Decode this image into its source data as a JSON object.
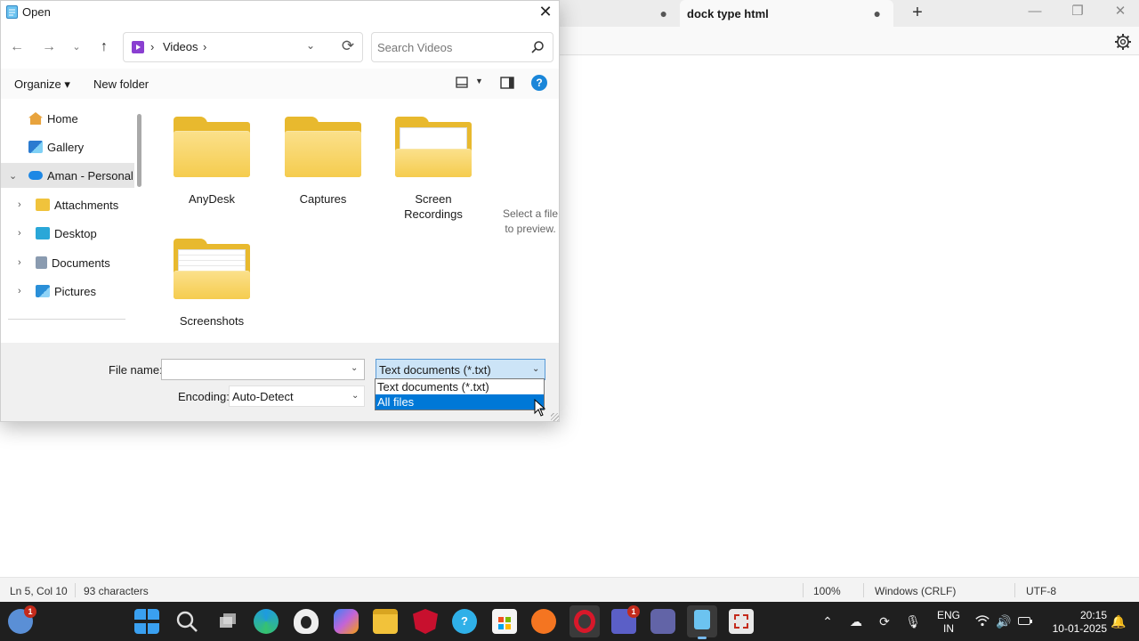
{
  "notepad": {
    "tabs": [
      {
        "label": ""
      },
      {
        "label": "dock type html"
      }
    ],
    "tab_dot": "●",
    "new_tab": "+",
    "status": {
      "position": "Ln 5, Col 10",
      "characters": "93 characters",
      "zoom": "100%",
      "line_ending": "Windows (CRLF)",
      "encoding": "UTF-8"
    }
  },
  "dialog": {
    "title": "Open",
    "close": "✕",
    "address": {
      "location": "Videos",
      "chevron": "›"
    },
    "search": {
      "placeholder": "Search Videos",
      "value": ""
    },
    "commands": {
      "organize": "Organize ▾",
      "new_folder": "New folder",
      "help": "?"
    },
    "nav_pane": {
      "items": [
        {
          "label": "Home",
          "icon": "home-icon",
          "color": "#e8a33d"
        },
        {
          "label": "Gallery",
          "icon": "gallery-icon",
          "color": "#2b7bd0"
        },
        {
          "label": "Aman - Personal",
          "icon": "onedrive-icon",
          "color": "#1e88e5"
        },
        {
          "label": "Attachments",
          "icon": "folder-icon",
          "color": "#f0c33c"
        },
        {
          "label": "Desktop",
          "icon": "desktop-icon",
          "color": "#2aa7d8"
        },
        {
          "label": "Documents",
          "icon": "documents-icon",
          "color": "#8a9bb0"
        },
        {
          "label": "Pictures",
          "icon": "pictures-icon",
          "color": "#2a8fd8"
        }
      ]
    },
    "folders": [
      {
        "label": "AnyDesk"
      },
      {
        "label": "Captures"
      },
      {
        "label": "Screen Recordings"
      },
      {
        "label": "Screenshots"
      }
    ],
    "preview_message": "Select a file to preview.",
    "file_name": {
      "label": "File name:",
      "value": ""
    },
    "file_type": {
      "selected": "Text documents (*.txt)",
      "options": [
        "Text documents (*.txt)",
        "All files"
      ],
      "highlighted": "All files"
    },
    "encoding": {
      "label": "Encoding:",
      "value": "Auto-Detect"
    }
  },
  "taskbar": {
    "apps": [
      {
        "name": "weather-widget",
        "color": "#5a8fd6",
        "badge": "1"
      },
      {
        "name": "start",
        "color": "#3aa0f0"
      },
      {
        "name": "search",
        "color": "#dddddd"
      },
      {
        "name": "task-view",
        "color": "#bbbbbb"
      },
      {
        "name": "edge",
        "color": "#1e9be0"
      },
      {
        "name": "linux-penguin",
        "color": "#eeeeee"
      },
      {
        "name": "copilot",
        "color": "#c364d8"
      },
      {
        "name": "file-explorer",
        "color": "#f2c23a"
      },
      {
        "name": "mcafee",
        "color": "#c8102e"
      },
      {
        "name": "get-help",
        "color": "#2fb0e8"
      },
      {
        "name": "microsoft-store",
        "color": "#f5f5f5"
      },
      {
        "name": "avast",
        "color": "#f47521"
      },
      {
        "name": "opera",
        "color": "#d7182a"
      },
      {
        "name": "teams-business",
        "color": "#5b5fc7",
        "badge": "1"
      },
      {
        "name": "teams",
        "color": "#6264a7"
      },
      {
        "name": "notepad",
        "color": "#6cc3f0"
      },
      {
        "name": "snipping-tool",
        "color": "#e8e8e8"
      }
    ],
    "language": {
      "line1": "ENG",
      "line2": "IN"
    },
    "clock": {
      "time": "20:15",
      "date": "10-01-2025"
    }
  }
}
